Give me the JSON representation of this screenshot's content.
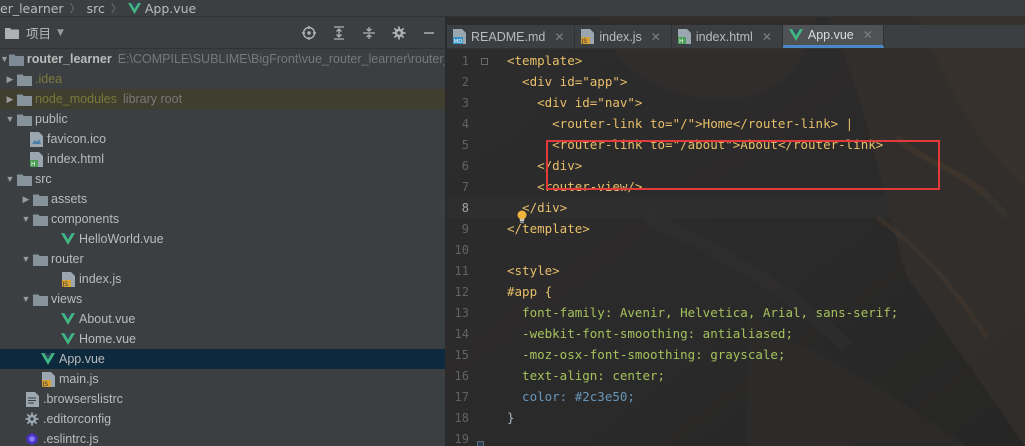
{
  "breadcrumb": {
    "items": [
      "er_learner",
      "src",
      "App.vue"
    ]
  },
  "project_panel": {
    "title": "项目",
    "tools": [
      "target-icon",
      "collapse-all-icon",
      "expand-icon",
      "gear-icon",
      "minimize-icon"
    ]
  },
  "tree": [
    {
      "name": "router_learner",
      "meta": "E:\\COMPILE\\SUBLIME\\BigFront\\vue_router_learner\\router_",
      "bold": true
    },
    {
      "name": ".idea",
      "style": "ignored"
    },
    {
      "name": "node_modules",
      "meta": "library root",
      "style": "ignored"
    },
    {
      "name": "public"
    },
    {
      "name": "favicon.ico"
    },
    {
      "name": "index.html"
    },
    {
      "name": "src"
    },
    {
      "name": "assets"
    },
    {
      "name": "components"
    },
    {
      "name": "HelloWorld.vue"
    },
    {
      "name": "router"
    },
    {
      "name": "index.js"
    },
    {
      "name": "views"
    },
    {
      "name": "About.vue"
    },
    {
      "name": "Home.vue"
    },
    {
      "name": "App.vue"
    },
    {
      "name": "main.js"
    },
    {
      "name": ".browserslistrc"
    },
    {
      "name": ".editorconfig"
    },
    {
      "name": ".eslintrc.js"
    }
  ],
  "tabs": [
    {
      "label": "README.md",
      "active": false
    },
    {
      "label": "index.js",
      "active": false
    },
    {
      "label": "index.html",
      "active": false
    },
    {
      "label": "App.vue",
      "active": true
    }
  ],
  "code_lines": [
    {
      "num": "1",
      "text": "<template>"
    },
    {
      "num": "2",
      "text": "  <div id=\"app\">"
    },
    {
      "num": "3",
      "text": "    <div id=\"nav\">"
    },
    {
      "num": "4",
      "text": "      <router-link to=\"/\">Home</router-link> |"
    },
    {
      "num": "5",
      "text": "      <router-link to=\"/about\">About</router-link>"
    },
    {
      "num": "6",
      "text": "    </div>"
    },
    {
      "num": "7",
      "text": "    <router-view/>"
    },
    {
      "num": "8",
      "text": "  </div>"
    },
    {
      "num": "9",
      "text": "</template>"
    },
    {
      "num": "10",
      "text": ""
    },
    {
      "num": "11",
      "text": "<style>"
    },
    {
      "num": "12",
      "text": "#app {"
    },
    {
      "num": "13",
      "text": "  font-family: Avenir, Helvetica, Arial, sans-serif;"
    },
    {
      "num": "14",
      "text": "  -webkit-font-smoothing: antialiased;"
    },
    {
      "num": "15",
      "text": "  -moz-osx-font-smoothing: grayscale;"
    },
    {
      "num": "16",
      "text": "  text-align: center;"
    },
    {
      "num": "17",
      "text": "  color: #2c3e50;"
    },
    {
      "num": "18",
      "text": "}"
    },
    {
      "num": "19",
      "text": ""
    }
  ],
  "colors": {
    "panel_bg": "#3c3f41",
    "editor_bg": "#2b2b2b",
    "selection": "#0d293e",
    "tag": "#e8bf6a",
    "string": "#a5c25c",
    "highlight_box": "#e03a3a",
    "swatch": "#2c3e50"
  }
}
